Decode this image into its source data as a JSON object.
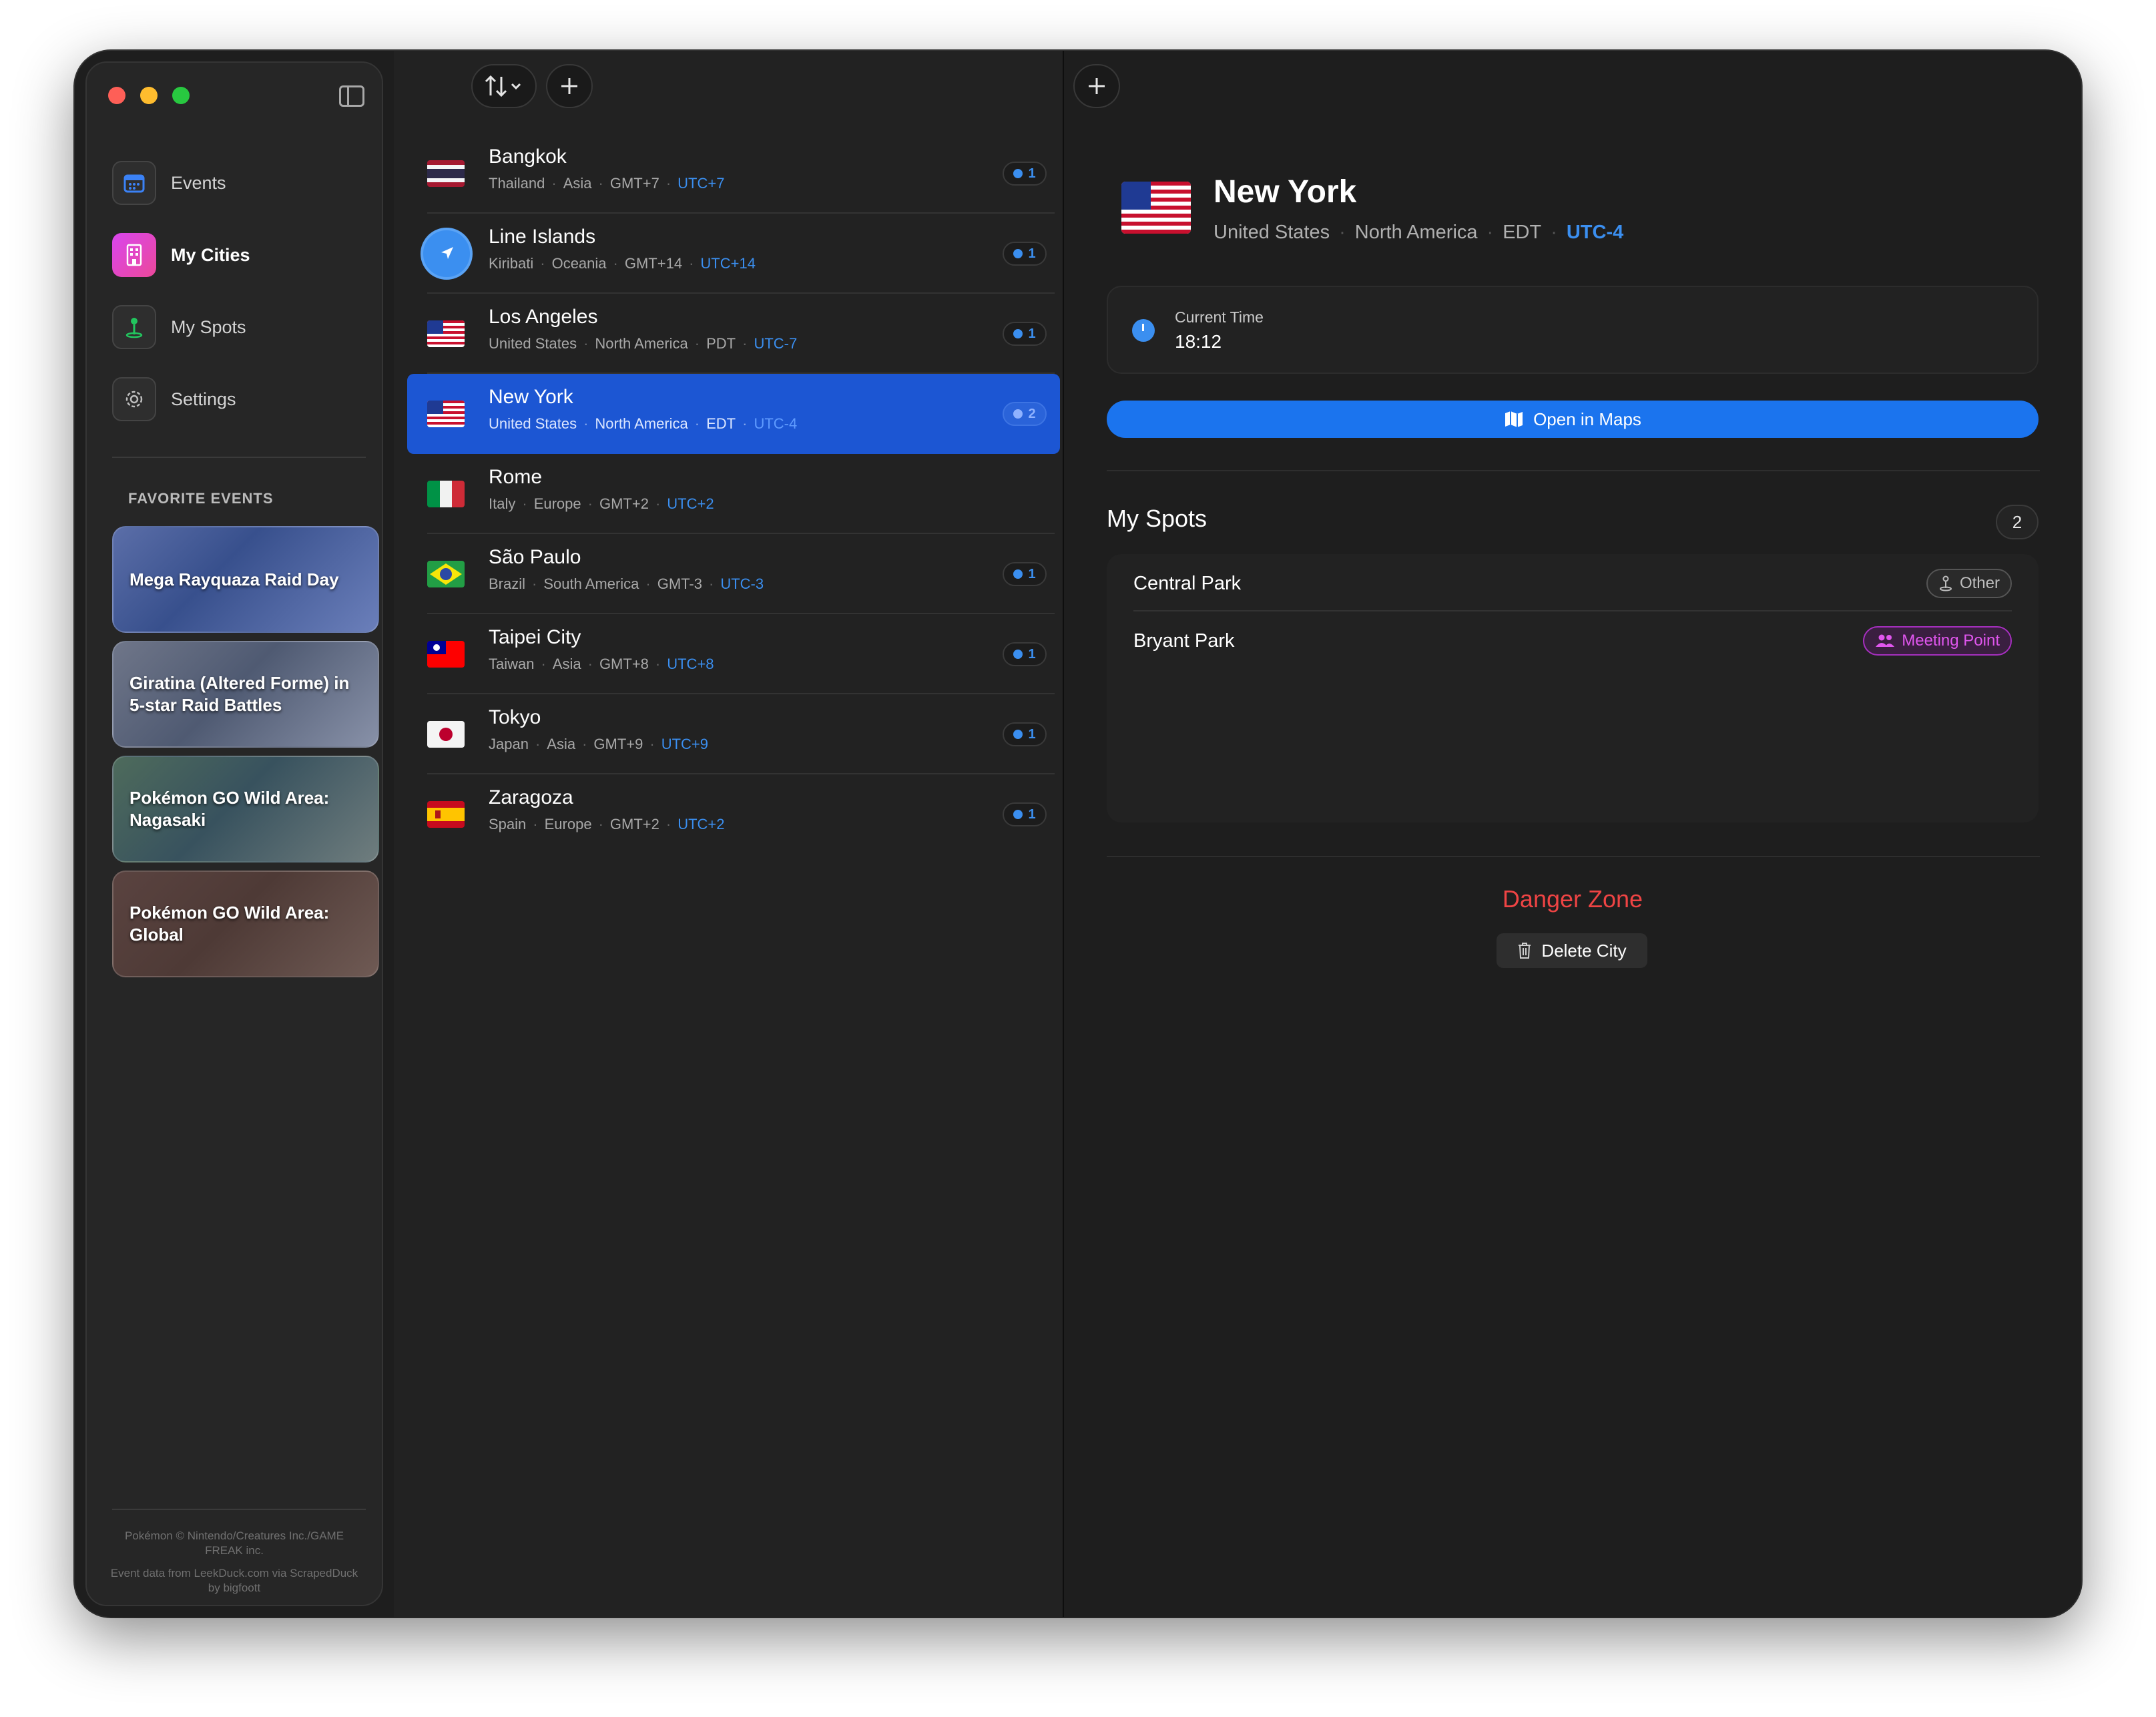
{
  "sidebar": {
    "nav": [
      {
        "label": "Events",
        "icon": "calendar-icon"
      },
      {
        "label": "My Cities",
        "icon": "building-icon"
      },
      {
        "label": "My Spots",
        "icon": "pin-icon"
      },
      {
        "label": "Settings",
        "icon": "gear-icon"
      }
    ],
    "active_index": 1,
    "favorites_title": "FAVORITE EVENTS",
    "favorites": [
      "Mega Rayquaza Raid Day",
      "Giratina (Altered Forme) in 5-star Raid Battles",
      "Pokémon GO Wild Area: Nagasaki",
      "Pokémon GO Wild Area: Global"
    ],
    "credits_line1": "Pokémon © Nintendo/Creatures Inc./GAME FREAK inc.",
    "credits_line2": "Event data from LeekDuck.com via ScrapedDuck by bigfoott"
  },
  "toolbar": {
    "sort_icon": "sort-icon",
    "add_icon": "plus-icon"
  },
  "cities": [
    {
      "name": "Bangkok",
      "country": "Thailand",
      "region": "Asia",
      "tz": "GMT+7",
      "utc": "UTC+7",
      "spots": "1"
    },
    {
      "name": "Line Islands",
      "country": "Kiribati",
      "region": "Oceania",
      "tz": "GMT+14",
      "utc": "UTC+14",
      "spots": "1"
    },
    {
      "name": "Los Angeles",
      "country": "United States",
      "region": "North America",
      "tz": "PDT",
      "utc": "UTC-7",
      "spots": "1"
    },
    {
      "name": "New York",
      "country": "United States",
      "region": "North America",
      "tz": "EDT",
      "utc": "UTC-4",
      "spots": "2"
    },
    {
      "name": "Rome",
      "country": "Italy",
      "region": "Europe",
      "tz": "GMT+2",
      "utc": "UTC+2",
      "spots": ""
    },
    {
      "name": "São Paulo",
      "country": "Brazil",
      "region": "South America",
      "tz": "GMT-3",
      "utc": "UTC-3",
      "spots": "1"
    },
    {
      "name": "Taipei City",
      "country": "Taiwan",
      "region": "Asia",
      "tz": "GMT+8",
      "utc": "UTC+8",
      "spots": "1"
    },
    {
      "name": "Tokyo",
      "country": "Japan",
      "region": "Asia",
      "tz": "GMT+9",
      "utc": "UTC+9",
      "spots": "1"
    },
    {
      "name": "Zaragoza",
      "country": "Spain",
      "region": "Europe",
      "tz": "GMT+2",
      "utc": "UTC+2",
      "spots": "1"
    }
  ],
  "selected_city_index": 3,
  "detail": {
    "title": "New York",
    "country": "United States",
    "region": "North America",
    "tz": "EDT",
    "utc": "UTC-4",
    "time_label": "Current Time",
    "time_value": "18:12",
    "maps_label": "Open in Maps",
    "spots_title": "My Spots",
    "spots_count": "2",
    "spots": [
      {
        "name": "Central Park",
        "tag": "Other"
      },
      {
        "name": "Bryant Park",
        "tag": "Meeting Point"
      }
    ],
    "danger_title": "Danger Zone",
    "delete_label": "Delete City"
  },
  "colors": {
    "accent": "#1b74ee",
    "selection": "#1c56d3",
    "danger": "#ef4444",
    "meeting": "#e056ee"
  }
}
